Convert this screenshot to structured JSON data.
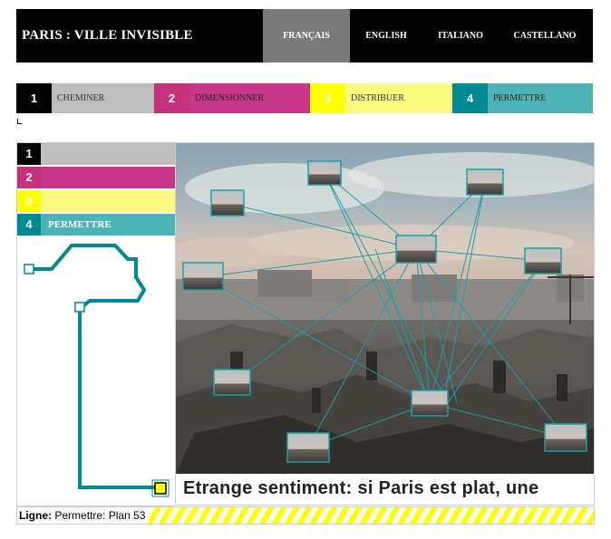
{
  "header": {
    "title": "PARIS : VILLE INVISIBLE",
    "languages": [
      {
        "label": "FRANÇAIS",
        "active": true
      },
      {
        "label": "ENGLISH",
        "active": false
      },
      {
        "label": "ITALIANO",
        "active": false
      },
      {
        "label": "CASTELLANO",
        "active": false
      }
    ]
  },
  "steps": [
    {
      "num": "1",
      "label": "CHEMINER",
      "color": "#000000"
    },
    {
      "num": "2",
      "label": "DIMENSIONNER",
      "color": "#c4307a"
    },
    {
      "num": "3",
      "label": "DISTRIBUER",
      "color": "#ffff00"
    },
    {
      "num": "4",
      "label": "PERMETTRE",
      "color": "#008a94"
    }
  ],
  "sidebar": {
    "rows": [
      {
        "num": "1",
        "label": ""
      },
      {
        "num": "2",
        "label": ""
      },
      {
        "num": "3",
        "label": ""
      },
      {
        "num": "4",
        "label": "PERMETTRE"
      }
    ],
    "route_color": "#008a94"
  },
  "main": {
    "image": "paris-rooftops-panorama",
    "thumbnails": 10
  },
  "caption": "Etrange sentiment: si Paris est plat, une",
  "ligne": {
    "label": "Ligne:",
    "value": "Permettre: Plan 53"
  }
}
